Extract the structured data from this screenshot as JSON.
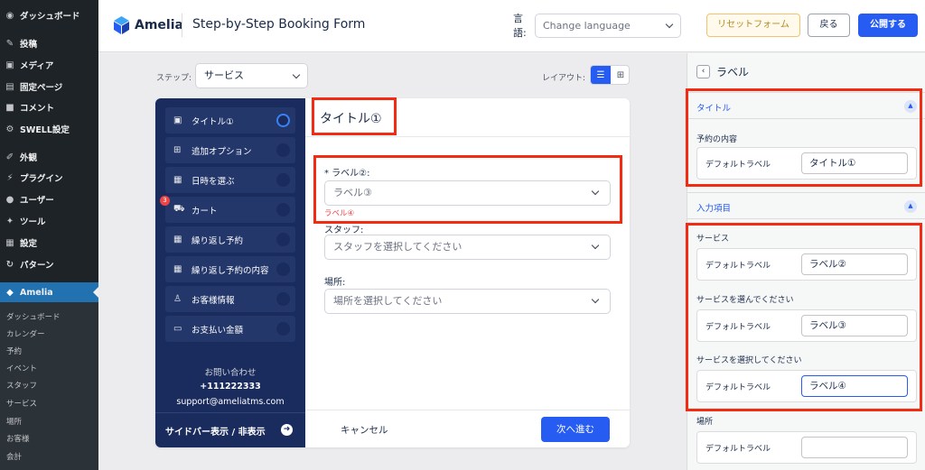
{
  "wp_menu": {
    "items": [
      {
        "label": "ダッシュボード",
        "icon": "dashboard-icon"
      },
      {
        "label": "投稿",
        "icon": "pin-icon"
      },
      {
        "label": "メディア",
        "icon": "media-icon"
      },
      {
        "label": "固定ページ",
        "icon": "page-icon"
      },
      {
        "label": "コメント",
        "icon": "comment-icon"
      },
      {
        "label": "SWELL設定",
        "icon": "settings-icon"
      },
      {
        "label": "外観",
        "icon": "brush-icon"
      },
      {
        "label": "プラグイン",
        "icon": "plugin-icon"
      },
      {
        "label": "ユーザー",
        "icon": "user-icon"
      },
      {
        "label": "ツール",
        "icon": "wrench-icon"
      },
      {
        "label": "設定",
        "icon": "settings-grid-icon"
      },
      {
        "label": "パターン",
        "icon": "pattern-icon"
      },
      {
        "label": "Amelia",
        "icon": "amelia-icon"
      }
    ],
    "submenu": [
      "ダッシュボード",
      "カレンダー",
      "予約",
      "イベント",
      "スタッフ",
      "サービス",
      "場所",
      "お客様",
      "会計"
    ]
  },
  "header": {
    "brand": "Amelia",
    "title": "Step-by-Step Booking Form",
    "lang_label": "言語:",
    "lang_placeholder": "Change language",
    "reset": "リセットフォーム",
    "back": "戻る",
    "publish": "公開する"
  },
  "canvas": {
    "step_label": "ステップ:",
    "step_value": "サービス",
    "layout_label": "レイアウト:"
  },
  "booking_form": {
    "steps": [
      {
        "label": "タイトル①",
        "icon": "calendar-check-icon",
        "active": true
      },
      {
        "label": "追加オプション",
        "icon": "plus-square-icon"
      },
      {
        "label": "日時を選ぶ",
        "icon": "calendar-icon"
      },
      {
        "label": "カート",
        "icon": "cart-icon",
        "badge": "3"
      },
      {
        "label": "繰り返し予約",
        "icon": "repeat-calendar-icon"
      },
      {
        "label": "繰り返し予約の内容",
        "icon": "calendar-list-icon"
      },
      {
        "label": "お客様情報",
        "icon": "person-icon"
      },
      {
        "label": "お支払い金額",
        "icon": "card-icon"
      }
    ],
    "contact": {
      "heading": "お問い合わせ",
      "phone": "+111222333",
      "email": "support@ameliatms.com"
    },
    "sidebar_toggle": "サイドバー表示 / 非表示",
    "main_title": "タイトル①",
    "service_label": "* ラベル②:",
    "service_placeholder": "ラベル③",
    "service_error": "ラベル④",
    "staff_label": "スタッフ:",
    "staff_placeholder": "スタッフを選択してください",
    "location_label": "場所:",
    "location_placeholder": "場所を選択してください",
    "cancel": "キャンセル",
    "next": "次へ進む"
  },
  "label_panel": {
    "title": "ラベル",
    "title_section": "タイトル",
    "booking_content": "予約の内容",
    "default_label": "デフォルトラベル",
    "title_value": "タイトル①",
    "input_section": "入力項目",
    "groups": [
      {
        "name": "サービス",
        "value": "ラベル②"
      },
      {
        "name": "サービスを選んでください",
        "value": "ラベル③"
      },
      {
        "name": "サービスを選択してください",
        "value": "ラベル④"
      },
      {
        "name": "場所",
        "value": ""
      }
    ]
  },
  "colors": {
    "accent": "#265cf2",
    "sidebar_dark": "#1a2b5e",
    "highlight": "#f22b12"
  }
}
